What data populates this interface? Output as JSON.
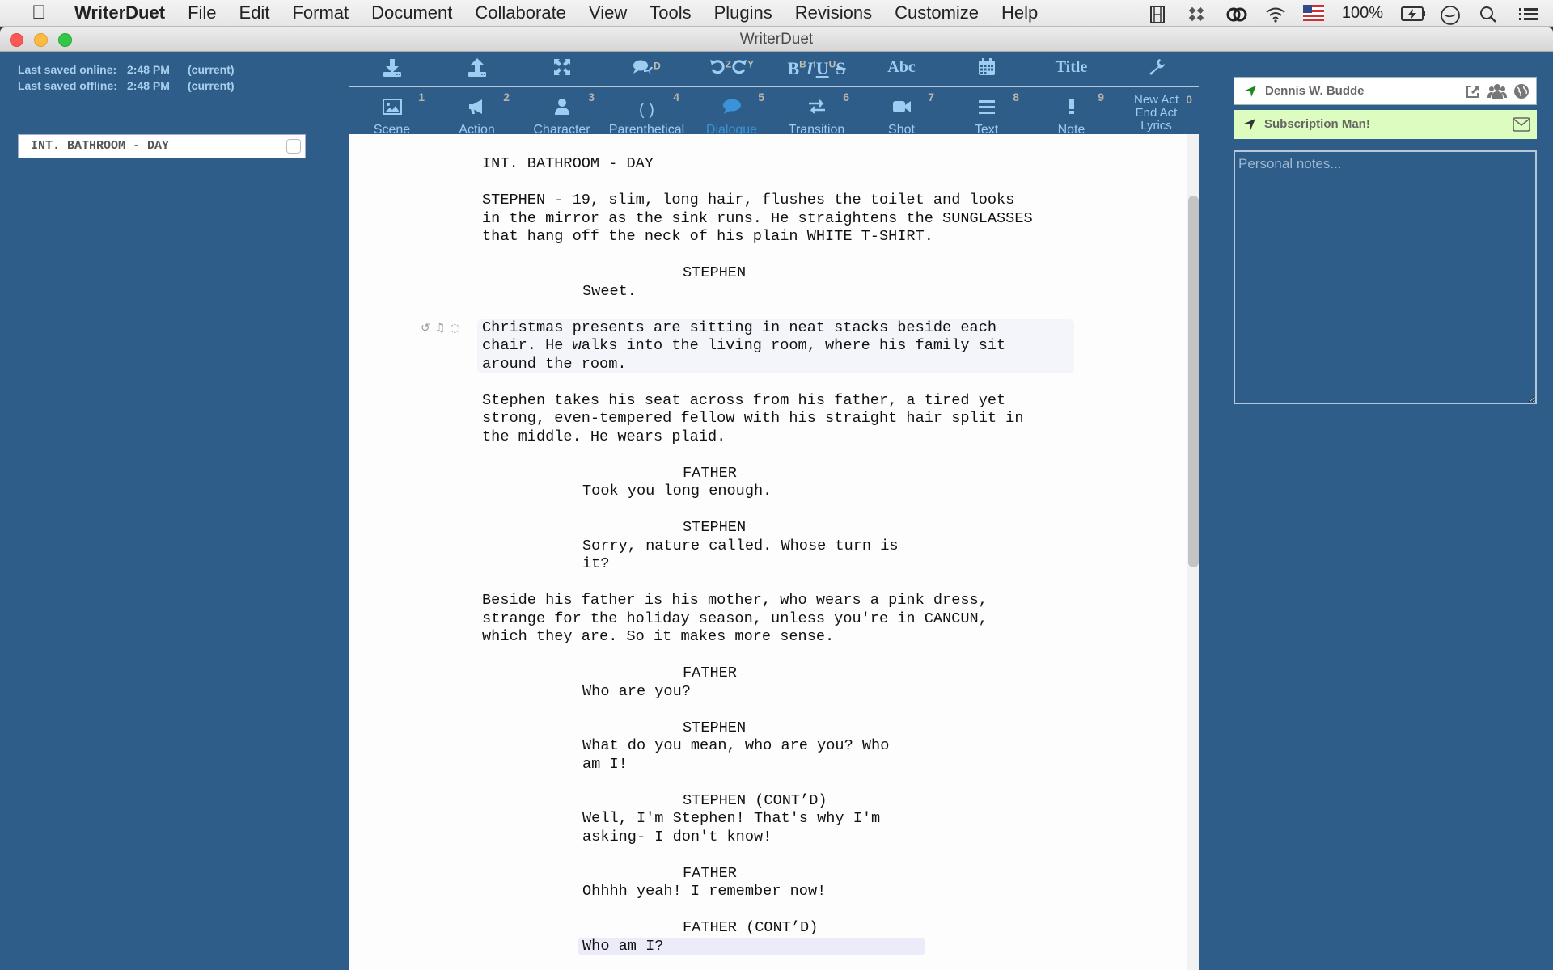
{
  "menubar": {
    "app": "WriterDuet",
    "items": [
      "File",
      "Edit",
      "Format",
      "Document",
      "Collaborate",
      "View",
      "Tools",
      "Plugins",
      "Revisions",
      "Customize",
      "Help"
    ],
    "tray": {
      "battery": "100%",
      "icons": [
        "film-strip-icon",
        "dropbox-icon",
        "creative-cloud-icon",
        "wifi-icon",
        "us-flag-icon",
        "battery-charging-icon",
        "clock-icon",
        "spotlight-search-icon",
        "notification-center-icon"
      ]
    }
  },
  "window": {
    "title": "WriterDuet"
  },
  "save_status": {
    "online_label": "Last saved online:",
    "online_time": "2:48 PM",
    "online_state": "(current)",
    "offline_label": "Last saved offline:",
    "offline_time": "2:48 PM",
    "offline_state": "(current)"
  },
  "scene_list": [
    {
      "label": "INT. BATHROOM - DAY",
      "checked": false
    }
  ],
  "toolbar": {
    "top": [
      {
        "name": "download",
        "glyph": "⤓"
      },
      {
        "name": "upload",
        "glyph": "⤒"
      },
      {
        "name": "fullscreen",
        "glyph": "⤧"
      },
      {
        "name": "dual-dialogue",
        "glyph": "💬",
        "shortcut": "D"
      },
      {
        "name": "undo-redo",
        "glyph": "↶↷",
        "shortcut_undo": "Z",
        "shortcut_redo": "Y"
      },
      {
        "name": "bold-italic-underline-strike",
        "bold": "B",
        "italic": "I",
        "underline": "U",
        "strike": "S",
        "sup_b": "B",
        "sup_i": "I",
        "sup_u": "U"
      },
      {
        "name": "spellcheck",
        "label": "Abc"
      },
      {
        "name": "calendar",
        "glyph": "▦"
      },
      {
        "name": "title-page",
        "label": "Title"
      },
      {
        "name": "settings",
        "glyph": "🔧"
      }
    ],
    "elements": [
      {
        "label": "Scene",
        "num": "1",
        "glyph": "▣"
      },
      {
        "label": "Action",
        "num": "2",
        "glyph": "📢"
      },
      {
        "label": "Character",
        "num": "3",
        "glyph": "●"
      },
      {
        "label": "Parenthetical",
        "num": "4",
        "glyph": "( )"
      },
      {
        "label": "Dialogue",
        "num": "5",
        "glyph": "●",
        "active": true
      },
      {
        "label": "Transition",
        "num": "6",
        "glyph": "⇄"
      },
      {
        "label": "Shot",
        "num": "7",
        "glyph": "■"
      },
      {
        "label": "Text",
        "num": "8",
        "glyph": "≡"
      },
      {
        "label": "Note",
        "num": "9",
        "glyph": "!"
      }
    ],
    "act_buttons": {
      "new_act": "New Act",
      "end_act": "End Act",
      "lyrics": "Lyrics",
      "num": "0"
    }
  },
  "script": [
    {
      "type": "scene",
      "text": "INT. BATHROOM - DAY"
    },
    {
      "type": "action",
      "text": "STEPHEN - 19, slim, long hair, flushes the toilet and looks\nin the mirror as the sink runs. He straightens the SUNGLASSES\nthat hang off the neck of his plain WHITE T-SHIRT."
    },
    {
      "type": "character",
      "text": "STEPHEN"
    },
    {
      "type": "dialogue",
      "text": "Sweet."
    },
    {
      "type": "action",
      "text": "Christmas presents are sitting in neat stacks beside each\nchair. He walks into the living room, where his family sit\naround the room.",
      "highlight": true
    },
    {
      "type": "action",
      "text": "Stephen takes his seat across from his father, a tired yet\nstrong, even-tempered fellow with his straight hair split in\nthe middle. He wears plaid."
    },
    {
      "type": "character",
      "text": "FATHER"
    },
    {
      "type": "dialogue",
      "text": "Took you long enough."
    },
    {
      "type": "character",
      "text": "STEPHEN"
    },
    {
      "type": "dialogue",
      "text": "Sorry, nature called. Whose turn is\nit?"
    },
    {
      "type": "action",
      "text": "Beside his father is his mother, who wears a pink dress,\nstrange for the holiday season, unless you're in CANCUN,\nwhich they are. So it makes more sense."
    },
    {
      "type": "character",
      "text": "FATHER"
    },
    {
      "type": "dialogue",
      "text": "Who are you?"
    },
    {
      "type": "character",
      "text": "STEPHEN"
    },
    {
      "type": "dialogue",
      "text": "What do you mean, who are you? Who\nam I!"
    },
    {
      "type": "character",
      "text": "STEPHEN (CONT’D)"
    },
    {
      "type": "dialogue",
      "text": "Well, I'm Stephen! That's why I'm\nasking- I don't know!"
    },
    {
      "type": "character",
      "text": "FATHER"
    },
    {
      "type": "dialogue",
      "text": "Ohhhh yeah! I remember now!"
    },
    {
      "type": "character",
      "text": "FATHER (CONT’D)"
    },
    {
      "type": "dialogue",
      "text": "Who am I?",
      "current": true
    }
  ],
  "row_tools": [
    "undo-icon",
    "voice-icon",
    "comment-icon"
  ],
  "right_panel": {
    "user_name": "Dennis W. Budde",
    "subscription_label": "Subscription Man!",
    "notes_placeholder": "Personal notes...",
    "notes_value": ""
  },
  "colors": {
    "app_bg": "#2d5d88",
    "toolbar_icon": "#9fcdf2",
    "active_element": "#3a93d8",
    "subscription_bg": "#dcfdbf",
    "user_location_icon": "#1b8a1b"
  }
}
